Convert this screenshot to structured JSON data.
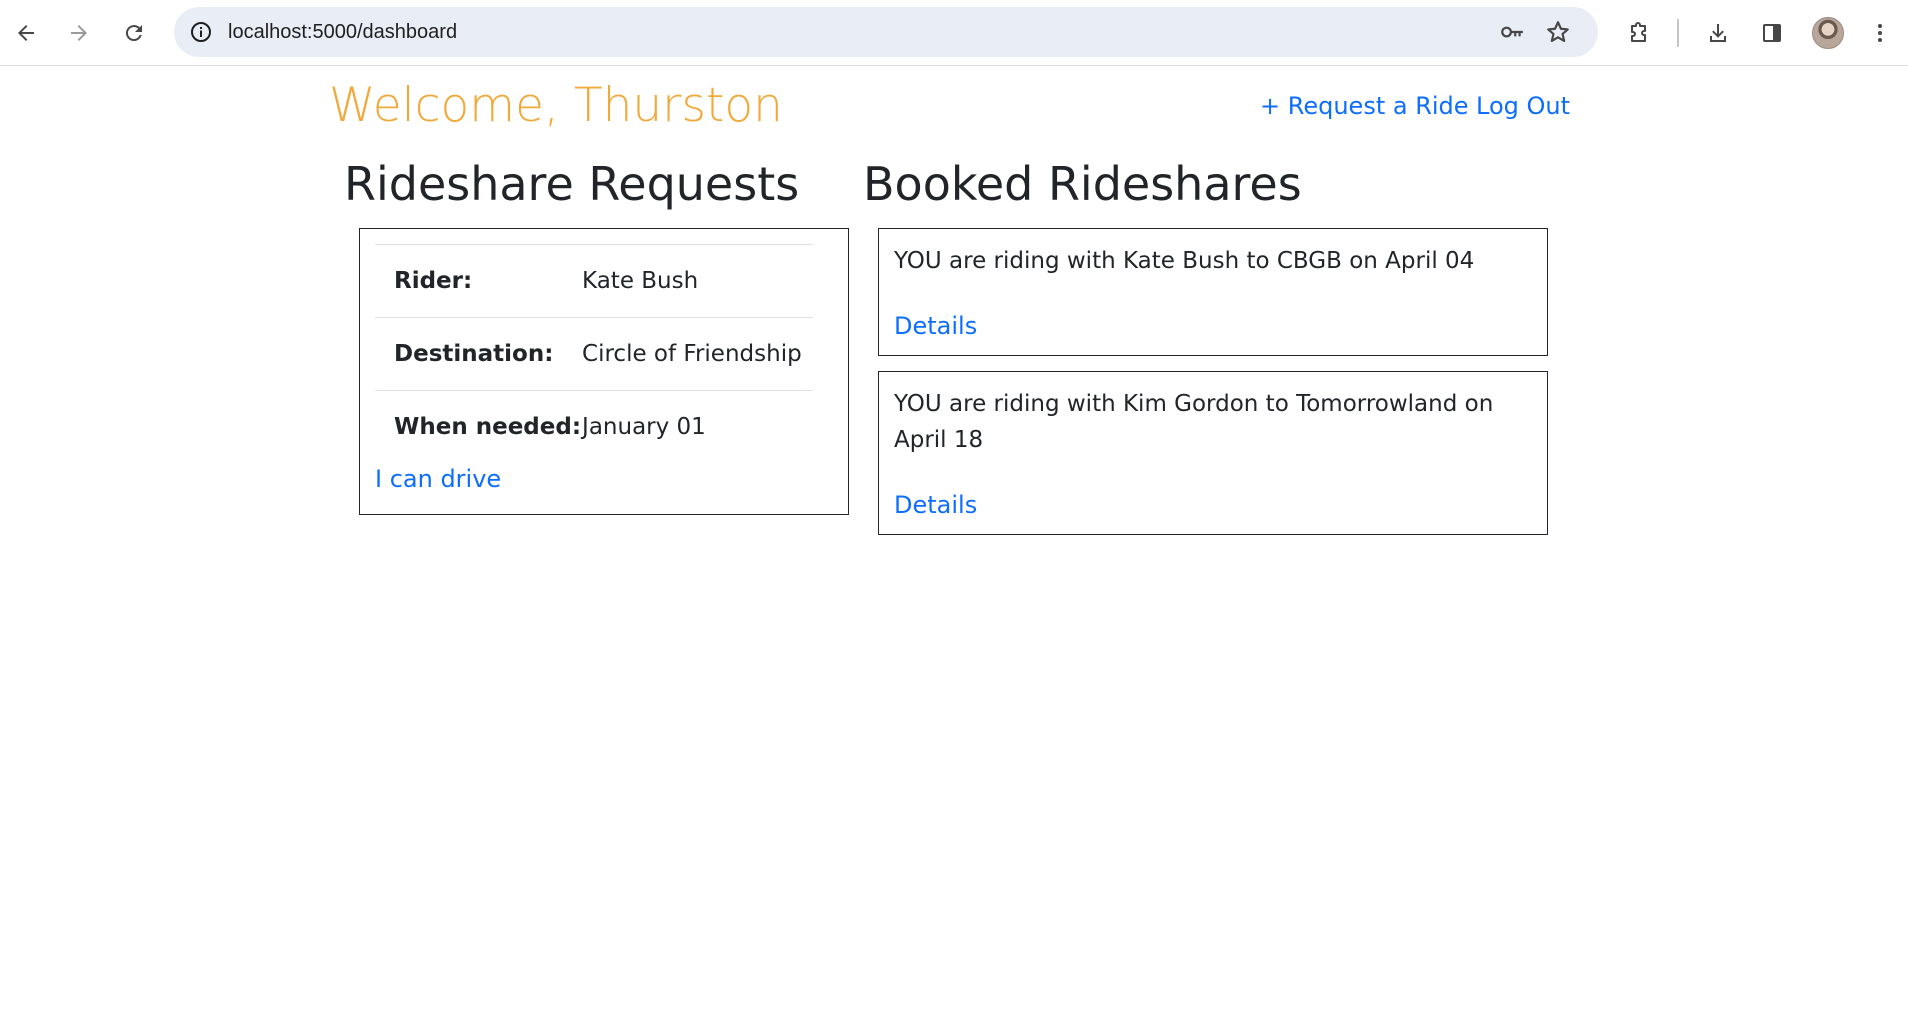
{
  "browser": {
    "url": "localhost:5000/dashboard",
    "icons": {
      "back": "arrow-left-icon",
      "forward": "arrow-right-icon",
      "reload": "reload-icon",
      "site_info": "info-icon",
      "password": "key-icon",
      "bookmark": "star-icon",
      "extensions": "puzzle-icon",
      "downloads": "download-icon",
      "side_panel": "side-panel-icon",
      "profile": "avatar",
      "menu": "kebab-menu-icon"
    }
  },
  "header": {
    "welcome": "Welcome, Thurston",
    "request_ride_link": "+ Request a Ride",
    "logout_link": "Log Out"
  },
  "requests": {
    "title": "Rideshare Requests",
    "items": [
      {
        "rows": [
          {
            "label": "Rider:",
            "value": "Kate Bush"
          },
          {
            "label": "Destination:",
            "value": "Circle of Friendship"
          },
          {
            "label": "When needed:",
            "value": "January 01"
          }
        ],
        "action_link": "I can drive"
      }
    ]
  },
  "booked": {
    "title": "Booked Rideshares",
    "items": [
      {
        "text": "YOU are riding with Kate Bush to CBGB on April 04",
        "link": "Details"
      },
      {
        "text": "YOU are riding with Kim Gordon to Tomorrowland on April 18",
        "link": "Details"
      }
    ]
  },
  "colors": {
    "welcome": "#f0a93b",
    "link": "#0d6efd",
    "text": "#212529",
    "card_border": "#212529",
    "omnibox_bg": "#e9eef6"
  }
}
